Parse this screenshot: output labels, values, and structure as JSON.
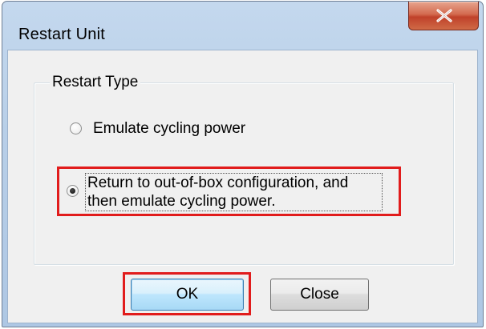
{
  "window": {
    "title": "Restart Unit"
  },
  "titlebar": {
    "close_icon": "close-x-icon"
  },
  "group": {
    "label": "Restart Type",
    "options": [
      {
        "label": "Emulate cycling power",
        "selected": false
      },
      {
        "label_line1": "Return to out-of-box configuration, and",
        "label_line2": "then emulate cycling power.",
        "selected": true
      }
    ]
  },
  "buttons": {
    "ok_label": "OK",
    "close_label": "Close"
  },
  "colors": {
    "highlight": "#e11c1c",
    "title_bar": "#b8cfe8",
    "close_button": "#c0412a"
  }
}
